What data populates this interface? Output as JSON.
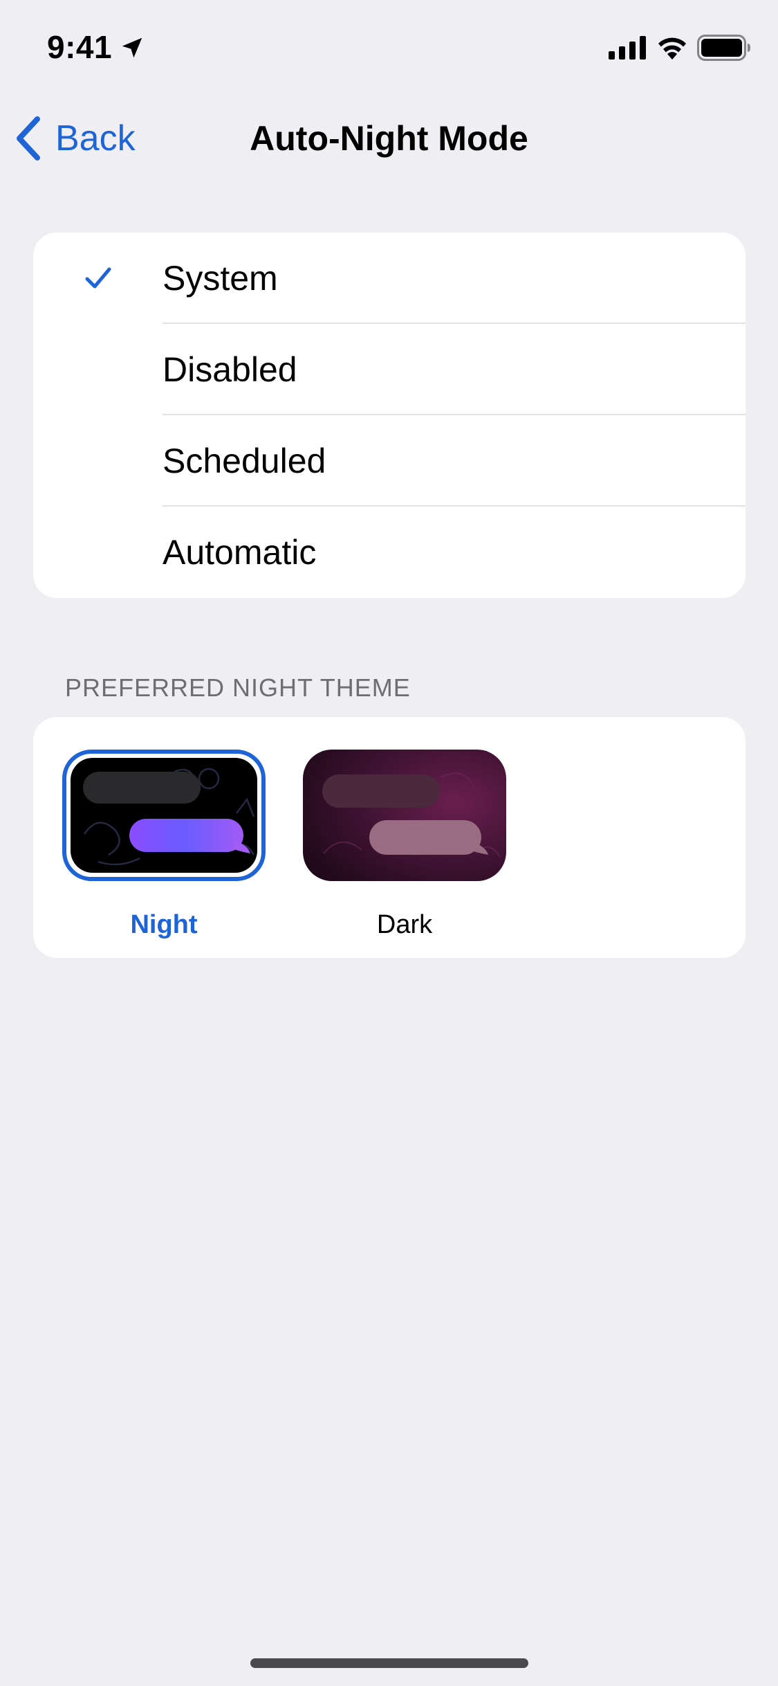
{
  "status_bar": {
    "time": "9:41",
    "icons": [
      "location-arrow-icon",
      "cellular-signal-icon",
      "wifi-icon",
      "battery-icon"
    ]
  },
  "nav": {
    "back_label": "Back",
    "title": "Auto-Night Mode"
  },
  "mode_options": [
    {
      "label": "System",
      "selected": true
    },
    {
      "label": "Disabled",
      "selected": false
    },
    {
      "label": "Scheduled",
      "selected": false
    },
    {
      "label": "Automatic",
      "selected": false
    }
  ],
  "night_theme": {
    "header": "PREFERRED NIGHT THEME",
    "themes": [
      {
        "label": "Night",
        "selected": true
      },
      {
        "label": "Dark",
        "selected": false
      }
    ]
  },
  "colors": {
    "accent": "#1E64D7",
    "background": "#EFEEF3",
    "card": "#FFFFFF",
    "secondary_text": "#6D6D72"
  }
}
